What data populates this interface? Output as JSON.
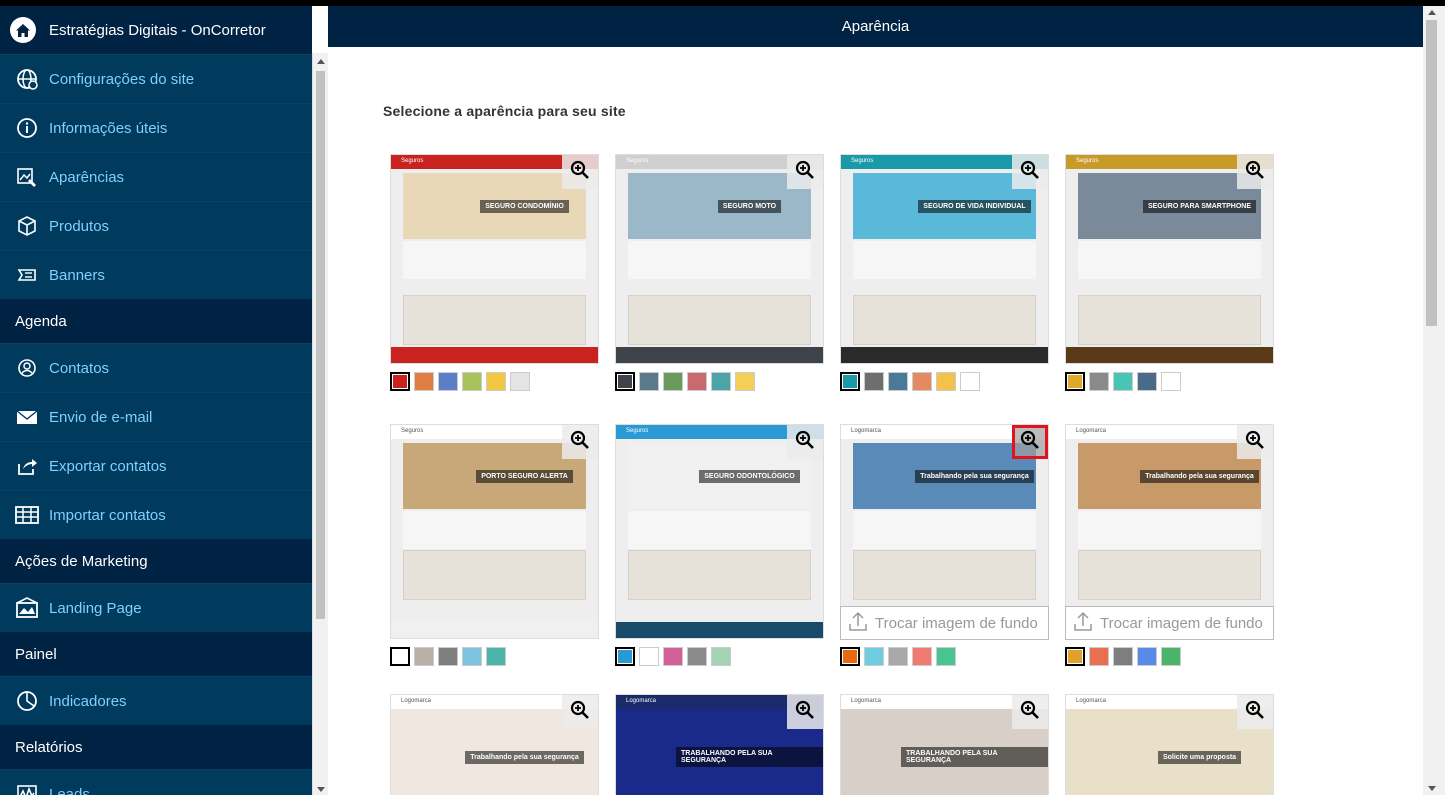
{
  "app": {
    "title": "Estratégias Digitais - OnCorretor"
  },
  "header": {
    "title": "Aparência"
  },
  "sidebar": {
    "items1": [
      {
        "label": "Configurações do site",
        "icon": "globe-icon"
      },
      {
        "label": "Informações úteis",
        "icon": "info-icon"
      },
      {
        "label": "Aparências",
        "icon": "appearance-icon"
      },
      {
        "label": "Produtos",
        "icon": "box-icon"
      },
      {
        "label": "Banners",
        "icon": "banner-icon"
      }
    ],
    "section_agenda": "Agenda",
    "items2": [
      {
        "label": "Contatos",
        "icon": "contacts-icon"
      },
      {
        "label": "Envio de e-mail",
        "icon": "envelope-icon"
      },
      {
        "label": "Exportar contatos",
        "icon": "export-icon"
      },
      {
        "label": "Importar contatos",
        "icon": "table-icon"
      }
    ],
    "section_marketing": "Ações de Marketing",
    "items3": [
      {
        "label": "Landing Page",
        "icon": "landing-page-icon"
      }
    ],
    "section_painel": "Painel",
    "items4": [
      {
        "label": "Indicadores",
        "icon": "pie-chart-icon"
      }
    ],
    "section_relatorios": "Relatórios",
    "items5": [
      {
        "label": "Leads",
        "icon": "leads-chart-icon"
      }
    ]
  },
  "main": {
    "title": "Selecione a aparência para seu site",
    "trocar_label": "Trocar imagem de fundo",
    "themes": [
      {
        "banner": "SEGURO CONDOMÍNIO",
        "swatches": [
          "#c8231f",
          "#e07e44",
          "#5b7fc4",
          "#a8c25c",
          "#f2c744",
          "#e4e4e4"
        ],
        "selected": 0,
        "brand": "Seguros"
      },
      {
        "banner": "SEGURO MOTO",
        "swatches": [
          "#3d4348",
          "#5a7a8a",
          "#6a9a5a",
          "#c86a6e",
          "#4aa4a8",
          "#f4cf58"
        ],
        "selected": 0,
        "brand": "Seguros"
      },
      {
        "banner": "SEGURO DE VIDA INDIVIDUAL",
        "swatches": [
          "#1a9aa8",
          "#6e6e6e",
          "#4a7a98",
          "#e48a62",
          "#f2c24a",
          "#ffffff"
        ],
        "selected": 0,
        "brand": "Seguros"
      },
      {
        "banner": "SEGURO PARA SMARTPHONE",
        "swatches": [
          "#e0a82a",
          "#8a8a8a",
          "#4ac4b4",
          "#4a6a8a",
          "#ffffff"
        ],
        "selected": 0,
        "brand": "Seguros"
      },
      {
        "banner": "PORTO SEGURO ALERTA",
        "swatches": [
          "#ffffff",
          "#b8b0a4",
          "#7e7e7e",
          "#7ec4e0",
          "#4ab4a8"
        ],
        "selected": 0,
        "brand": "Seguros"
      },
      {
        "banner": "SEGURO ODONTOLÓGICO",
        "swatches": [
          "#2a9ad4",
          "#ffffff",
          "#d4609a",
          "#8a8a8a",
          "#a4d4b4"
        ],
        "selected": 0,
        "brand": "Seguros"
      },
      {
        "banner": "Trabalhando pela sua segurança",
        "swatches": [
          "#e86a10",
          "#70cce0",
          "#a8a8a8",
          "#f07a70",
          "#4ac490"
        ],
        "selected": 0,
        "brand": "Logomarca",
        "trocar": true,
        "highlight": true
      },
      {
        "banner": "Trabalhando pela sua segurança",
        "swatches": [
          "#e0a22a",
          "#e87050",
          "#7e7e7e",
          "#5a8ae8",
          "#4ab46a"
        ],
        "selected": 0,
        "brand": "Logomarca",
        "trocar": true
      },
      {
        "banner": "Trabalhando pela sua segurança",
        "swatches": [],
        "brand": "Logomarca"
      },
      {
        "banner": "TRABALHANDO PELA SUA SEGURANÇA",
        "swatches": [],
        "brand": "Logomarca"
      },
      {
        "banner": "TRABALHANDO PELA SUA SEGURANÇA",
        "swatches": [],
        "brand": "Logomarca"
      },
      {
        "banner": "Solicite uma proposta",
        "swatches": [],
        "brand": "Logomarca"
      }
    ]
  }
}
